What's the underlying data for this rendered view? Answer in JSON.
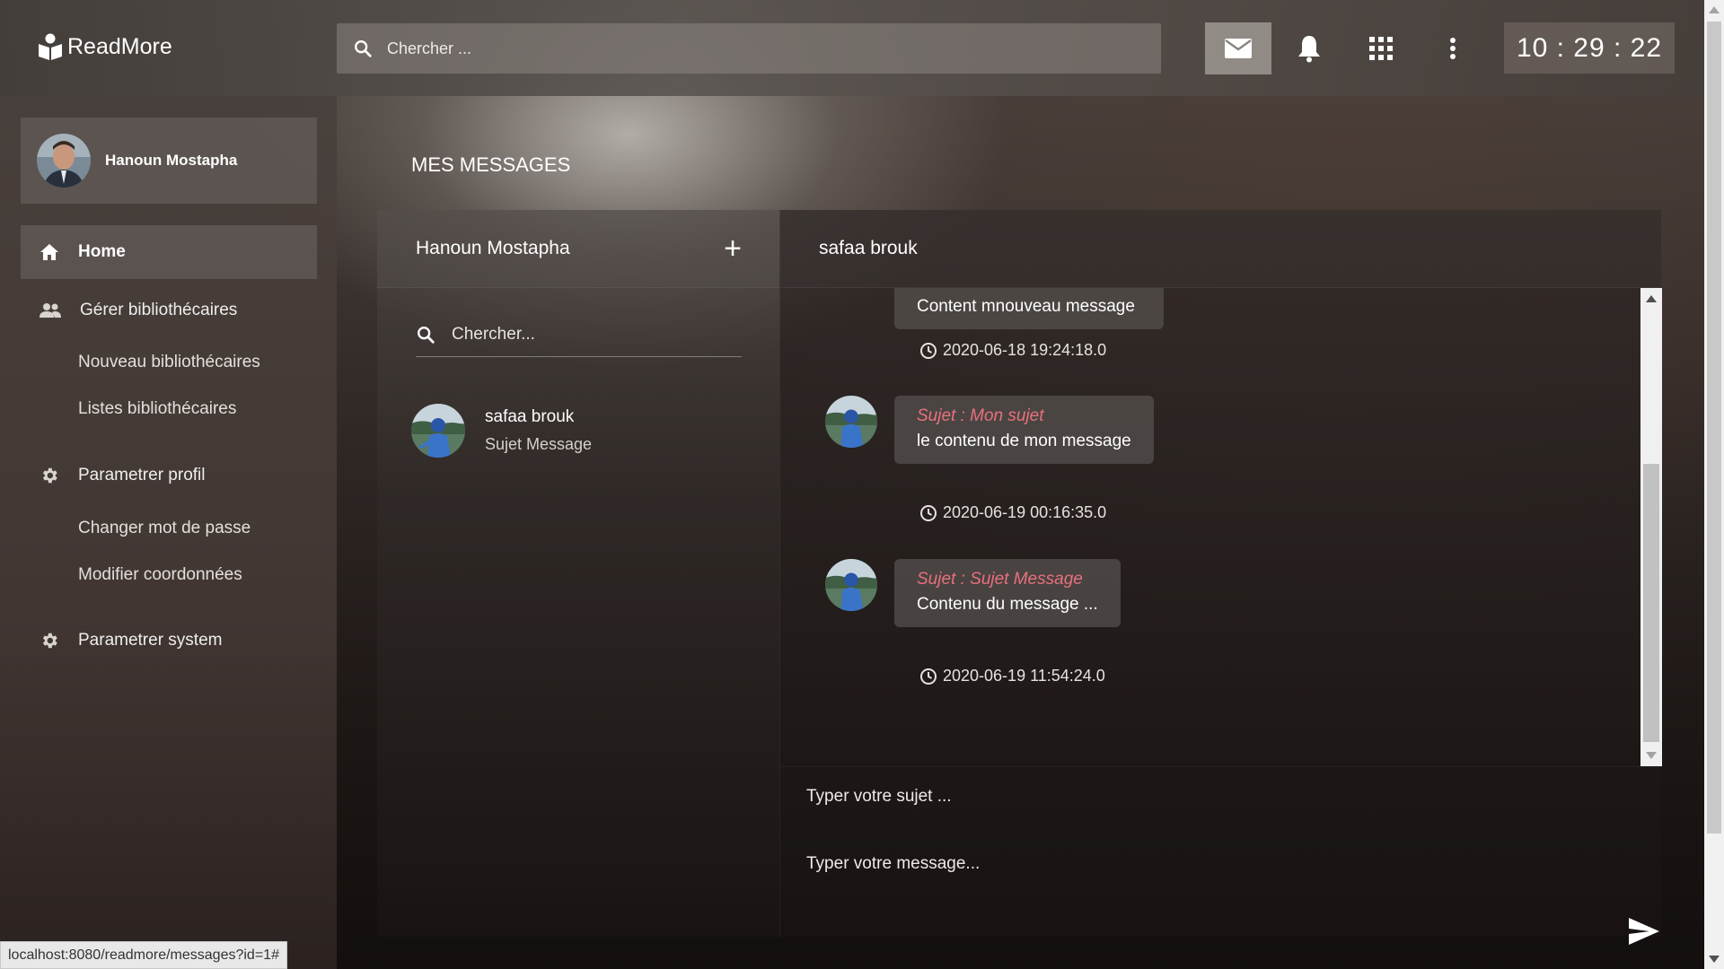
{
  "header": {
    "app_name": "ReadMore",
    "search_placeholder": "Chercher ...",
    "clock": "10 : 29 : 22"
  },
  "sidebar": {
    "profile_name": "Hanoun Mostapha",
    "items": [
      {
        "label": "Home",
        "icon": "home-icon",
        "active": true
      },
      {
        "label": "Gérer bibliothécaires",
        "icon": "people-icon"
      },
      {
        "label": "Parametrer profil",
        "icon": "gear-icon"
      },
      {
        "label": "Parametrer system",
        "icon": "gear-icon"
      }
    ],
    "subitems": {
      "gerer": [
        "Nouveau bibliothécaires",
        "Listes bibliothécaires"
      ],
      "profil": [
        "Changer mot de passe",
        "Modifier coordonnées"
      ]
    }
  },
  "main": {
    "title": "MES MESSAGES",
    "left_panel": {
      "owner": "Hanoun Mostapha",
      "add_label": "+",
      "search_placeholder": "Chercher...",
      "contacts": [
        {
          "name": "safaa brouk",
          "subject": "Sujet Message"
        }
      ]
    },
    "right_panel": {
      "contact_name": "safaa brouk",
      "messages": [
        {
          "subject": "",
          "body": "Content mnouveau message",
          "timestamp": "2020-06-18 19:24:18.0"
        },
        {
          "subject": "Sujet : Mon sujet",
          "body": "le contenu de mon message",
          "timestamp": "2020-06-19 00:16:35.0"
        },
        {
          "subject": "Sujet : Sujet Message",
          "body": "Contenu du message ...",
          "timestamp": "2020-06-19 11:54:24.0"
        }
      ],
      "subject_placeholder": "Typer votre sujet ...",
      "message_placeholder": "Typer votre message..."
    }
  },
  "status_bar": {
    "url": "localhost:8080/readmore/messages?id=1#"
  },
  "colors": {
    "subject_accent": "#e8707e",
    "bubble_bg": "#55504e"
  }
}
